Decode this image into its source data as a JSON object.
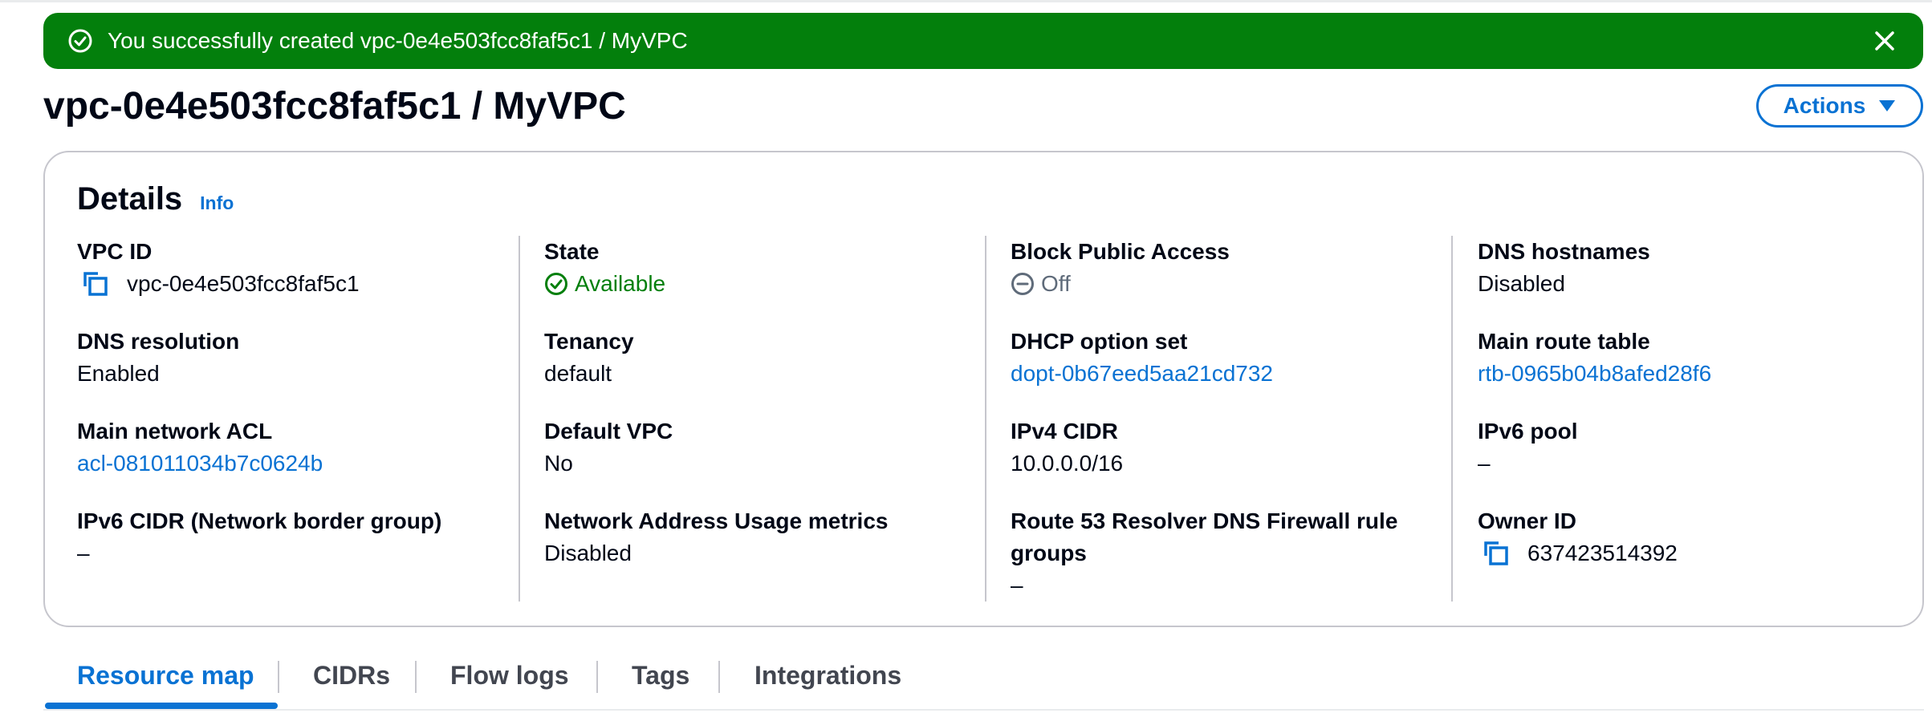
{
  "flash": {
    "message": "You successfully created vpc-0e4e503fcc8faf5c1 / MyVPC",
    "color": "#037f0c",
    "icon": "check-circle-icon",
    "dismiss_icon": "close-icon"
  },
  "header": {
    "title": "vpc-0e4e503fcc8faf5c1 / MyVPC",
    "actions_label": "Actions",
    "actions_icon": "caret-down-icon"
  },
  "details": {
    "title": "Details",
    "info_label": "Info",
    "columns": [
      [
        {
          "label": "VPC ID",
          "value": "vpc-0e4e503fcc8faf5c1",
          "copyable": true
        },
        {
          "label": "DNS resolution",
          "value": "Enabled"
        },
        {
          "label": "Main network ACL",
          "value": "acl-081011034b7c0624b",
          "link": true
        },
        {
          "label": "IPv6 CIDR (Network border group)",
          "value": "–"
        }
      ],
      [
        {
          "label": "State",
          "value": "Available",
          "status": "success",
          "icon": "check-circle-icon"
        },
        {
          "label": "Tenancy",
          "value": "default"
        },
        {
          "label": "Default VPC",
          "value": "No"
        },
        {
          "label": "Network Address Usage metrics",
          "value": "Disabled"
        }
      ],
      [
        {
          "label": "Block Public Access",
          "value": "Off",
          "status": "stopped",
          "icon": "minus-circle-icon"
        },
        {
          "label": "DHCP option set",
          "value": "dopt-0b67eed5aa21cd732",
          "link": true
        },
        {
          "label": "IPv4 CIDR",
          "value": "10.0.0.0/16"
        },
        {
          "label": "Route 53 Resolver DNS Firewall rule groups",
          "value": "–"
        }
      ],
      [
        {
          "label": "DNS hostnames",
          "value": "Disabled"
        },
        {
          "label": "Main route table",
          "value": "rtb-0965b04b8afed28f6",
          "link": true
        },
        {
          "label": "IPv6 pool",
          "value": "–"
        },
        {
          "label": "Owner ID",
          "value": "637423514392",
          "copyable": true
        }
      ]
    ]
  },
  "tabs": [
    {
      "label": "Resource map",
      "active": true
    },
    {
      "label": "CIDRs"
    },
    {
      "label": "Flow logs"
    },
    {
      "label": "Tags"
    },
    {
      "label": "Integrations"
    }
  ],
  "colors": {
    "link": "#0972d3",
    "success": "#037f0c",
    "text": "#000716",
    "muted": "#5f6b7a",
    "border": "#c6c6cd"
  }
}
